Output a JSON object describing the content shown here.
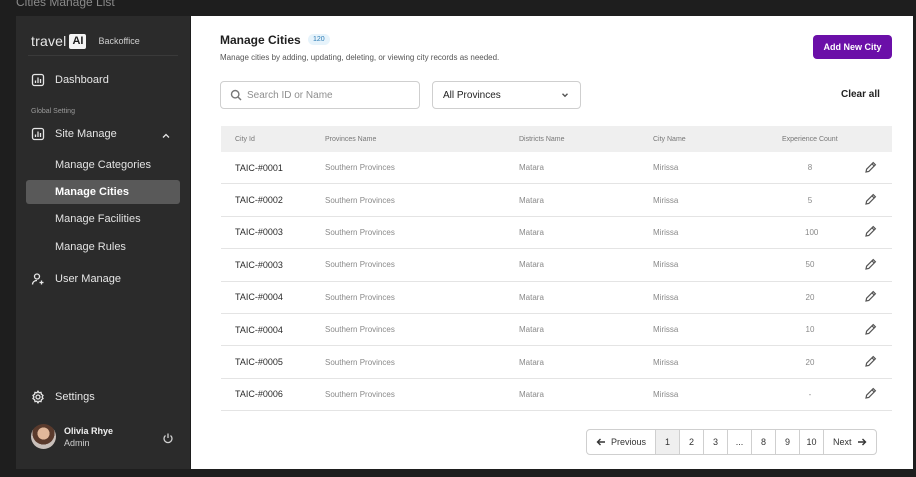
{
  "window": {
    "title": "Cities Manage List"
  },
  "sidebar": {
    "brand": {
      "name": "travel",
      "badge": "AI",
      "subtitle": "Backoffice"
    },
    "dashboard_label": "Dashboard",
    "section_label": "Global Setting",
    "site_manage_label": "Site Manage",
    "sub_items": [
      {
        "label": "Manage Categories",
        "active": false
      },
      {
        "label": "Manage Cities",
        "active": true
      },
      {
        "label": "Manage Facilities",
        "active": false
      },
      {
        "label": "Manage Rules",
        "active": false
      }
    ],
    "user_manage_label": "User Manage",
    "settings_label": "Settings",
    "user": {
      "name": "Olivia Rhye",
      "role": "Admin"
    }
  },
  "main": {
    "title": "Manage Cities",
    "count": "120",
    "description": "Manage cities by adding, updating, deleting, or viewing city records as needed.",
    "add_button": "Add New City",
    "search": {
      "placeholder": "Search ID or Name",
      "value": ""
    },
    "province_filter": {
      "selected": "All Provinces"
    },
    "clear_all": "Clear all",
    "table": {
      "columns": [
        "City Id",
        "Provinces Name",
        "Districts Name",
        "City Name",
        "Experience Count"
      ],
      "rows": [
        [
          "TAIC-#0001",
          "Southern Provinces",
          "Matara",
          "Mirissa",
          "8"
        ],
        [
          "TAIC-#0002",
          "Southern Provinces",
          "Matara",
          "Mirissa",
          "5"
        ],
        [
          "TAIC-#0003",
          "Southern Provinces",
          "Matara",
          "Mirissa",
          "100"
        ],
        [
          "TAIC-#0003",
          "Southern Provinces",
          "Matara",
          "Mirissa",
          "50"
        ],
        [
          "TAIC-#0004",
          "Southern Provinces",
          "Matara",
          "Mirissa",
          "20"
        ],
        [
          "TAIC-#0004",
          "Southern Provinces",
          "Matara",
          "Mirissa",
          "10"
        ],
        [
          "TAIC-#0005",
          "Southern Provinces",
          "Matara",
          "Mirissa",
          "20"
        ],
        [
          "TAIC-#0006",
          "Southern Provinces",
          "Matara",
          "Mirissa",
          "-"
        ]
      ]
    },
    "pagination": {
      "previous": "Previous",
      "next": "Next",
      "pages": [
        "1",
        "2",
        "3",
        "...",
        "8",
        "9",
        "10"
      ],
      "current": "1"
    }
  },
  "colors": {
    "accent": "#6b0fa8",
    "sidebar_bg": "#2b2b2b",
    "active_item": "#595959",
    "badge_bg": "#e6f3fb",
    "badge_text": "#2c7cb5"
  },
  "icons": {
    "dashboard": "chart-square-icon",
    "site_manage": "chart-square-icon",
    "user_manage": "user-plus-icon",
    "settings": "gear-icon",
    "logout": "power-icon",
    "search": "search-icon",
    "edit": "pencil-icon"
  }
}
